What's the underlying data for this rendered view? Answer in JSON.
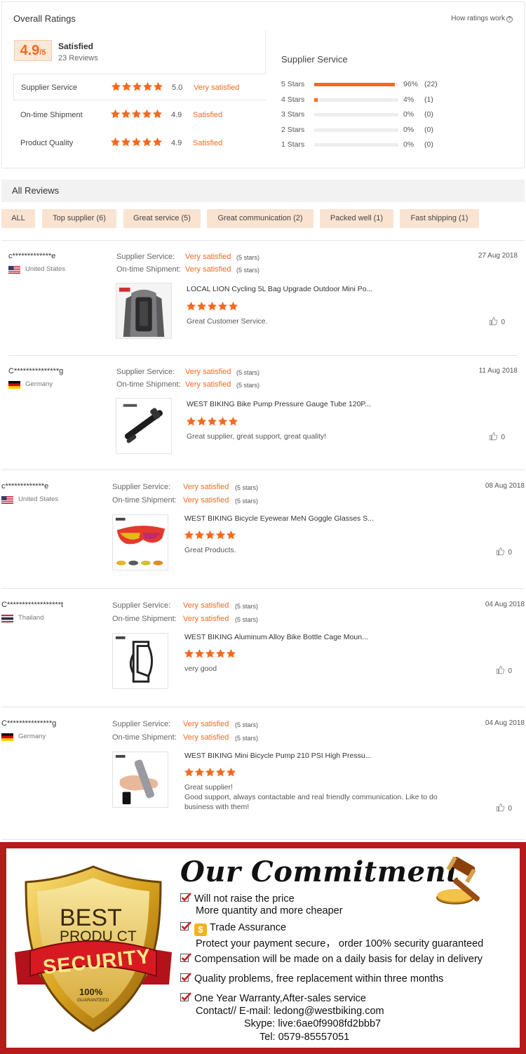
{
  "overall": {
    "title": "Overall Ratings",
    "how_link": "How ratings work",
    "score": "4.9",
    "score_out_of": "/5",
    "satisfaction": "Satisfied",
    "reviews_count": "23 Reviews",
    "categories": [
      {
        "name": "Supplier Service",
        "stars": 5,
        "value": "5.0",
        "label": "Very satisfied"
      },
      {
        "name": "On-time Shipment",
        "stars": 5,
        "value": "4.9",
        "label": "Satisfied"
      },
      {
        "name": "Product Quality",
        "stars": 5,
        "value": "4.9",
        "label": "Satisfied"
      }
    ],
    "distribution_title": "Supplier Service",
    "distribution": [
      {
        "label": "5 Stars",
        "fraction": 0.96,
        "pct": "96%",
        "count": "(22)"
      },
      {
        "label": "4 Stars",
        "fraction": 0.04,
        "pct": "4%",
        "count": "(1)"
      },
      {
        "label": "3 Stars",
        "fraction": 0,
        "pct": "0%",
        "count": "(0)"
      },
      {
        "label": "2 Stars",
        "fraction": 0,
        "pct": "0%",
        "count": "(0)"
      },
      {
        "label": "1 Stars",
        "fraction": 0,
        "pct": "0%",
        "count": "(0)"
      }
    ]
  },
  "all_reviews": {
    "title": "All Reviews",
    "filters": [
      "ALL",
      "Top supplier (6)",
      "Great service (5)",
      "Great communication (2)",
      "Packed well (1)",
      "Fast shipping (1)"
    ]
  },
  "meta_labels": {
    "supplier_service": "Supplier Service:",
    "ontime_shipment": "On-time Shipment:"
  },
  "reviews": [
    {
      "user": "c*************e",
      "country": "United States",
      "flag": "us",
      "supplier_service": "Very satisfied",
      "supplier_stars": "(5 stars)",
      "shipment": "Very satisfied",
      "shipment_stars": "(5 stars)",
      "date": "27 Aug 2018",
      "product": "LOCAL LION Cycling 5L Bag Upgrade Outdoor Mini Po...",
      "rating": 5,
      "comment": "Great Customer Service.",
      "likes": "0"
    },
    {
      "user": "C***************g",
      "country": "Germany",
      "flag": "de",
      "supplier_service": "Very satisfied",
      "supplier_stars": "(5 stars)",
      "shipment": "Very satisfied",
      "shipment_stars": "(5 stars)",
      "date": "11 Aug 2018",
      "product": "WEST BIKING Bike Pump Pressure Gauge Tube 120P...",
      "rating": 5,
      "comment": "Great supplier, great support, great quality!",
      "likes": "0"
    },
    {
      "user": "c*************e",
      "country": "United States",
      "flag": "us",
      "supplier_service": "Very satisfied",
      "supplier_stars": "(5 stars)",
      "shipment": "Very satisfied",
      "shipment_stars": "(5 stars)",
      "date": "08 Aug 2018",
      "product": "WEST BIKING Bicycle Eyewear MeN Goggle Glasses S...",
      "rating": 5,
      "comment": "Great Products.",
      "likes": "0"
    },
    {
      "user": "C******************t",
      "country": "Thailand",
      "flag": "th",
      "supplier_service": "Very satisfied",
      "supplier_stars": "(5 stars)",
      "shipment": "Very satisfied",
      "shipment_stars": "(5 stars)",
      "date": "04 Aug 2018",
      "product": "WEST BIKING Aluminum Alloy Bike Bottle Cage Moun...",
      "rating": 5,
      "comment": "very good",
      "likes": "0"
    },
    {
      "user": "C***************g",
      "country": "Germany",
      "flag": "de",
      "supplier_service": "Very satisfied",
      "supplier_stars": "(5 stars)",
      "shipment": "Very satisfied",
      "shipment_stars": "(5 stars)",
      "date": "04 Aug 2018",
      "product": "WEST BIKING Mini Bicycle Pump 210 PSI High Pressu...",
      "rating": 5,
      "comment_lines": [
        "Great supplier!",
        "Good support, always contactable and real friendly communication. Like to do",
        "business with them!"
      ],
      "likes": "0"
    }
  ],
  "commitment": {
    "title": "Our Commitment",
    "badge_line1": "BEST",
    "badge_line2": "PRODU CT",
    "badge_ribbon": "SECURITY",
    "badge_pct": "100%",
    "badge_small": "GUARANTEED",
    "items": [
      {
        "line": "Will not raise the price",
        "sub": "More quantity and more cheaper"
      },
      {
        "line": "Trade Assurance",
        "sub": "Protect your payment secure， order 100% security guaranteed"
      },
      {
        "line": "Compensation will be made on a daily basis for delay in delivery"
      },
      {
        "line": "Quality problems, free replacement within three months"
      },
      {
        "line": "One Year Warranty,After-sales service"
      }
    ],
    "contact_email": "Contact// E-mail: ledong@westbiking.com",
    "contact_skype": "Skype: live:6ae0f9908fd2bbb7",
    "contact_tel": "Tel: 0579-85557051"
  },
  "colors": {
    "accent": "#f26a21",
    "filter_bg": "#fbe3d1",
    "banner_red": "#b41b1b"
  }
}
